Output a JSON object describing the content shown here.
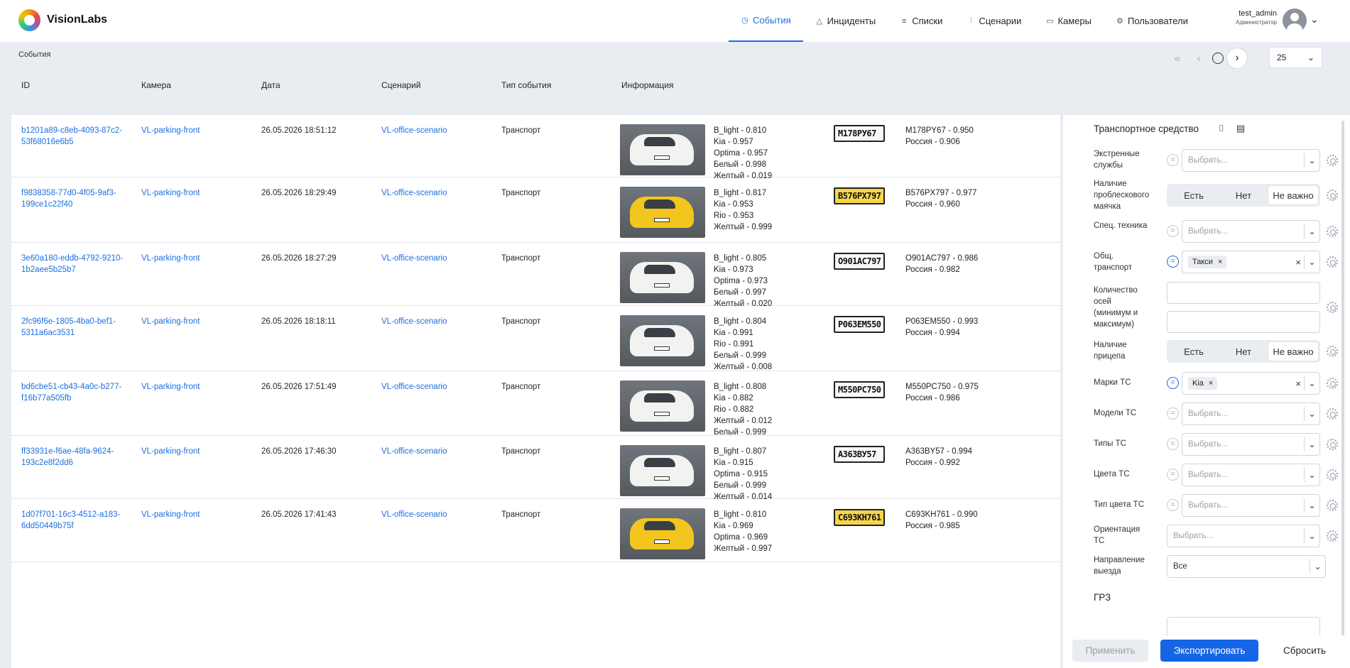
{
  "header": {
    "brand": "VisionLabs",
    "nav": [
      {
        "label": "События",
        "icon": "clock-icon",
        "glyph": "◷",
        "active": true
      },
      {
        "label": "Инциденты",
        "icon": "warning-triangle-icon",
        "glyph": "△"
      },
      {
        "label": "Списки",
        "icon": "list-icon",
        "glyph": "≡"
      },
      {
        "label": "Сценарии",
        "icon": "sliders-icon",
        "glyph": "⫶"
      },
      {
        "label": "Камеры",
        "icon": "camera-icon",
        "glyph": "▭"
      },
      {
        "label": "Пользователи",
        "icon": "users-icon",
        "glyph": "⚙"
      }
    ],
    "user": {
      "name": "test_admin",
      "role": "Администратор"
    }
  },
  "breadcrumb": "События",
  "pagination": {
    "per_page": "25"
  },
  "columns": {
    "id": "ID",
    "camera": "Камера",
    "date": "Дата",
    "scenario": "Сценарий",
    "type": "Тип события",
    "info": "Информация"
  },
  "events": [
    {
      "id": "b1201a89-c8eb-4093-87c2-53f68016e6b5",
      "camera": "VL-parking-front",
      "date": "26.05.2026 18:51:12",
      "scenario": "VL-office-scenario",
      "type": "Транспорт",
      "car_color": "white",
      "attrs": [
        "B_light - 0.810",
        "Kia - 0.957",
        "Optima - 0.957",
        "Белый - 0.998",
        "Желтый - 0.019"
      ],
      "plate_img": "М178РУ67",
      "plate": [
        "M178PY67 - 0.950",
        "Россия - 0.906"
      ]
    },
    {
      "id": "f9838358-77d0-4f05-9af3-199ce1c22f40",
      "camera": "VL-parking-front",
      "date": "26.05.2026 18:29:49",
      "scenario": "VL-office-scenario",
      "type": "Транспорт",
      "car_color": "yellow",
      "attrs": [
        "B_light - 0.817",
        "Kia - 0.953",
        "Rio - 0.953",
        "Желтый - 0.999"
      ],
      "plate_img": "В576РХ797",
      "plate": [
        "B576PX797 - 0.977",
        "Россия - 0.960"
      ]
    },
    {
      "id": "3e60a180-eddb-4792-9210-1b2aee5b25b7",
      "camera": "VL-parking-front",
      "date": "26.05.2026 18:27:29",
      "scenario": "VL-office-scenario",
      "type": "Транспорт",
      "car_color": "white",
      "attrs": [
        "B_light - 0.805",
        "Kia - 0.973",
        "Optima - 0.973",
        "Белый - 0.997",
        "Желтый - 0.020"
      ],
      "plate_img": "О901АС797",
      "plate": [
        "O901AC797 - 0.986",
        "Россия - 0.982"
      ]
    },
    {
      "id": "2fc96f6e-1805-4ba0-bef1-5311a6ac3531",
      "camera": "VL-parking-front",
      "date": "26.05.2026 18:18:11",
      "scenario": "VL-office-scenario",
      "type": "Транспорт",
      "car_color": "white",
      "attrs": [
        "B_light - 0.804",
        "Kia - 0.991",
        "Rio - 0.991",
        "Белый - 0.999",
        "Желтый - 0.008"
      ],
      "plate_img": "Р063ЕМ550",
      "plate": [
        "P063EM550 - 0.993",
        "Россия - 0.994"
      ]
    },
    {
      "id": "bd6cbe51-cb43-4a0c-b277-f16b77a505fb",
      "camera": "VL-parking-front",
      "date": "26.05.2026 17:51:49",
      "scenario": "VL-office-scenario",
      "type": "Транспорт",
      "car_color": "white",
      "attrs": [
        "B_light - 0.808",
        "Kia - 0.882",
        "Rio - 0.882",
        "Желтый - 0.012",
        "Белый - 0.999"
      ],
      "plate_img": "М550РС750",
      "plate": [
        "M550PC750 - 0.975",
        "Россия - 0.986"
      ]
    },
    {
      "id": "ff33931e-f6ae-48fa-9624-193c2e8f2dd6",
      "camera": "VL-parking-front",
      "date": "26.05.2026 17:46:30",
      "scenario": "VL-office-scenario",
      "type": "Транспорт",
      "car_color": "white",
      "attrs": [
        "B_light - 0.807",
        "Kia - 0.915",
        "Optima - 0.915",
        "Белый - 0.999",
        "Желтый - 0.014"
      ],
      "plate_img": "А363ВУ57",
      "plate": [
        "A363BY57 - 0.994",
        "Россия - 0.992"
      ]
    },
    {
      "id": "1d07f701-16c3-4512-a183-6dd50449b75f",
      "camera": "VL-parking-front",
      "date": "26.05.2026 17:41:43",
      "scenario": "VL-office-scenario",
      "type": "Транспорт",
      "car_color": "yellow",
      "attrs": [
        "B_light - 0.810",
        "Kia - 0.969",
        "Optima - 0.969",
        "Желтый - 0.997"
      ],
      "plate_img": "С693КН761",
      "plate": [
        "C693KH761 - 0.990",
        "Россия - 0.985"
      ]
    }
  ],
  "filters": {
    "title": "Транспортное средство",
    "placeholder": "Выбрать...",
    "emergency": "Экстренные службы",
    "beacon": "Наличие проблескового маячка",
    "special": "Спец. техника",
    "public_transport": "Общ. транспорт",
    "public_transport_chip": "Такси",
    "axles": "Количество осей (минимум и максимум)",
    "trailer": "Наличие прицепа",
    "brands": "Марки ТС",
    "brands_chip": "Kia",
    "models": "Модели ТС",
    "types": "Типы ТС",
    "colors": "Цвета ТС",
    "color_type": "Тип цвета ТС",
    "orientation": "Ориентация ТС",
    "direction": "Направление выезда",
    "direction_value": "Все",
    "seg_yes": "Есть",
    "seg_no": "Нет",
    "seg_any": "Не важно",
    "grz": "ГРЗ"
  },
  "actions": {
    "apply": "Применить",
    "export": "Экспортировать",
    "reset": "Сбросить"
  }
}
